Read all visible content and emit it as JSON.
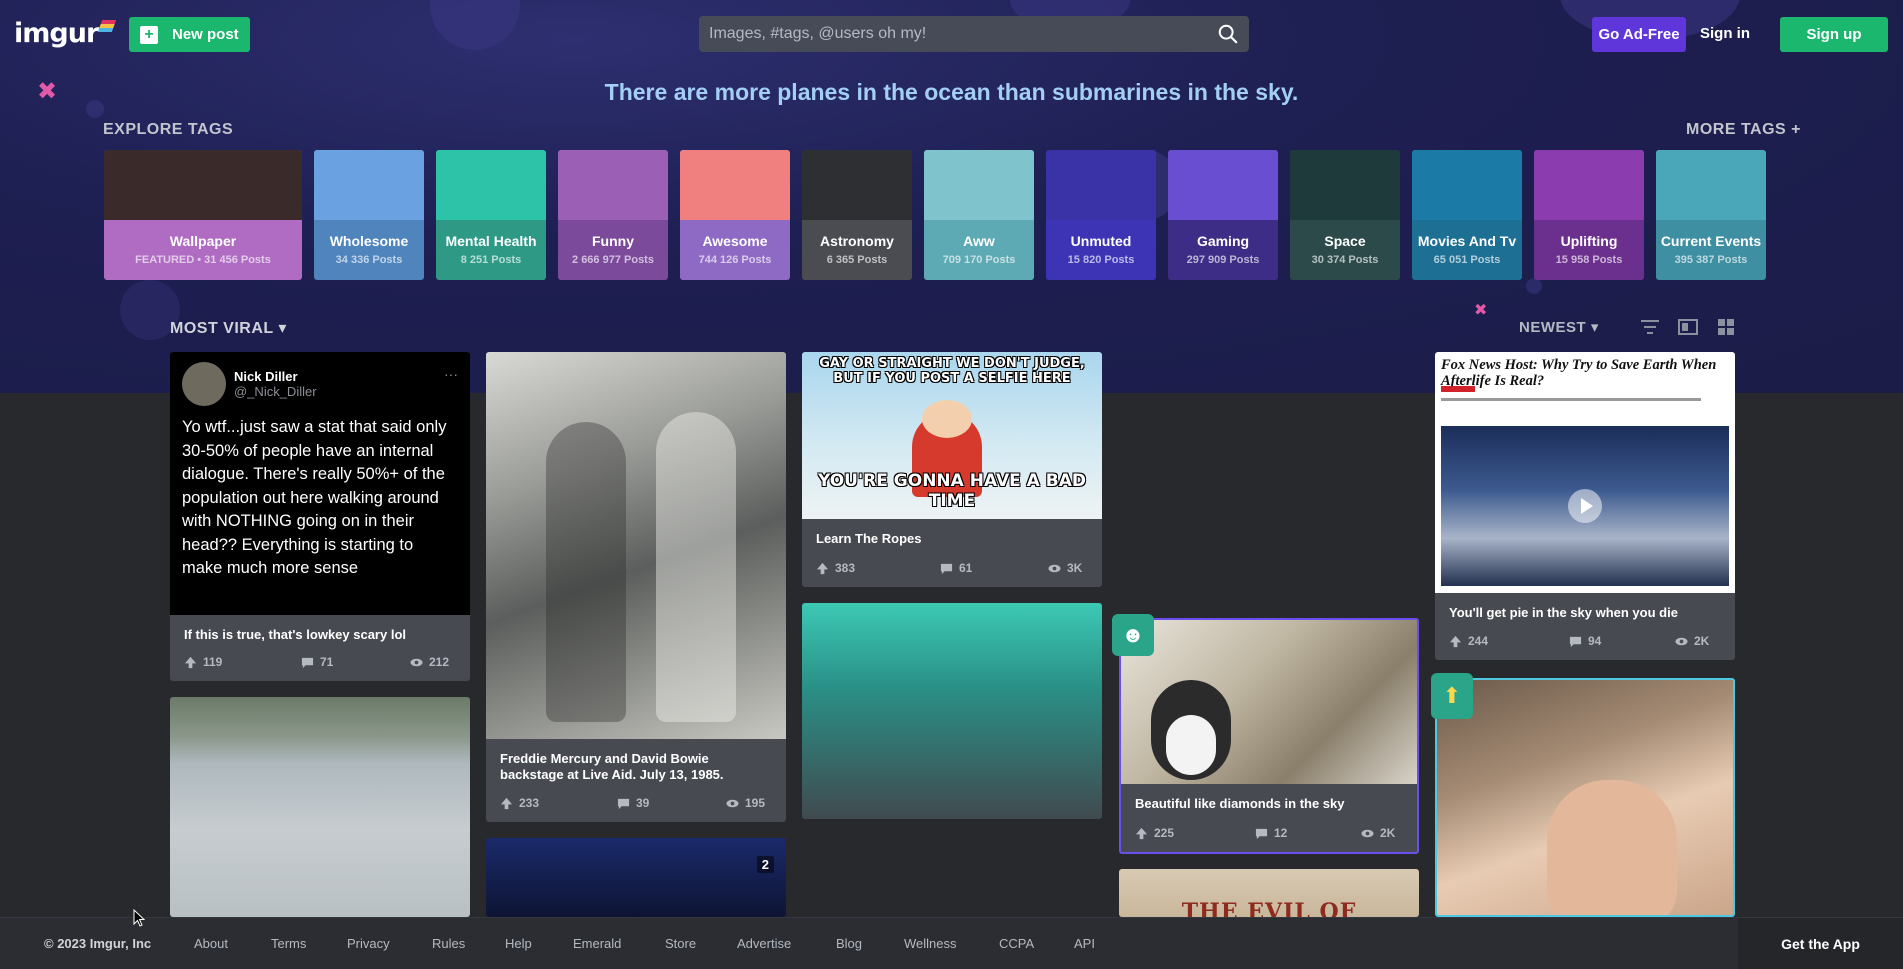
{
  "header": {
    "logo_text": "imgur",
    "new_post_label": "New post",
    "search_placeholder": "Images, #tags, @users oh my!",
    "ad_free_label": "Go Ad-Free",
    "sign_in_label": "Sign in",
    "sign_up_label": "Sign up"
  },
  "tagline": "There are more planes in the ocean than submarines in the sky.",
  "explore": {
    "title": "EXPLORE TAGS",
    "more_label": "MORE TAGS +",
    "tags": [
      {
        "name": "Wallpaper",
        "count": "FEATURED • 31 456 Posts",
        "color": "#b06cc3",
        "img": "#3a2a2a"
      },
      {
        "name": "Wholesome",
        "count": "34 336 Posts",
        "color": "#4f84bd",
        "img": "#6aa1e0"
      },
      {
        "name": "Mental Health",
        "count": "8 251 Posts",
        "color": "#2e9a86",
        "img": "#2cc3a8"
      },
      {
        "name": "Funny",
        "count": "2 666 977 Posts",
        "color": "#7b4a9b",
        "img": "#9b5fb5"
      },
      {
        "name": "Awesome",
        "count": "744 126 Posts",
        "color": "#8f6ac4",
        "img": "#f07f7f"
      },
      {
        "name": "Astronomy",
        "count": "6 365 Posts",
        "color": "#4a4c52",
        "img": "#2d2f33"
      },
      {
        "name": "Aww",
        "count": "709 170 Posts",
        "color": "#5eaab4",
        "img": "#7fc4cc"
      },
      {
        "name": "Unmuted",
        "count": "15 820 Posts",
        "color": "#3c34b5",
        "img": "#3a33a8"
      },
      {
        "name": "Gaming",
        "count": "297 909 Posts",
        "color": "#3e2d86",
        "img": "#6a4ed1"
      },
      {
        "name": "Space",
        "count": "30 374 Posts",
        "color": "#2c4a4a",
        "img": "#1f3a3a"
      },
      {
        "name": "Movies And Tv",
        "count": "65 051 Posts",
        "color": "#1e6f94",
        "img": "#1b7aa6"
      },
      {
        "name": "Uplifting",
        "count": "15 958 Posts",
        "color": "#6b2f8e",
        "img": "#8b3db0"
      },
      {
        "name": "Current Events",
        "count": "395 387 Posts",
        "color": "#3f8fa2",
        "img": "#4aa6b9"
      }
    ]
  },
  "sort": {
    "left_label": "MOST VIRAL",
    "right_label": "NEWEST"
  },
  "cards": {
    "c1": {
      "author": "Nick Diller",
      "handle": "@_Nick_Diller",
      "tweet": "Yo wtf...just saw a stat that said only 30-50% of people have an internal dialogue.  There's really 50%+ of the population out here walking around with NOTHING going on in their head?? Everything is starting to make much more sense",
      "title": "If this is true, that's lowkey scary lol",
      "ups": "119",
      "comments": "71",
      "views": "212"
    },
    "c2": {
      "title": "Freddie Mercury and David Bowie backstage at Live Aid. July 13, 1985.",
      "ups": "233",
      "comments": "39",
      "views": "195"
    },
    "c3": {
      "top_text": "GAY OR STRAIGHT WE DON'T JUDGE, BUT IF YOU POST A SELFIE HERE",
      "bottom_text": "YOU'RE GONNA HAVE A BAD TIME",
      "title": "Learn The Ropes",
      "ups": "383",
      "comments": "61",
      "views": "3K"
    },
    "c4": {
      "title": "Beautiful like diamonds in the sky",
      "ups": "225",
      "comments": "12",
      "views": "2K"
    },
    "c5": {
      "headline": "Fox News Host: Why Try to Save Earth When Afterlife Is Real?",
      "title": "You'll get pie in the sky when you die",
      "ups": "244",
      "comments": "94",
      "views": "2K"
    },
    "c6": {
      "badge": "2"
    },
    "c7": {
      "overlay_text": "THE EVIL OF"
    }
  },
  "footer": {
    "copyright": "© 2023 Imgur, Inc",
    "links": [
      "About",
      "Terms",
      "Privacy",
      "Rules",
      "Help",
      "Emerald",
      "Store",
      "Advertise",
      "Blog",
      "Wellness",
      "CCPA",
      "API"
    ],
    "get_app": "Get the App"
  }
}
